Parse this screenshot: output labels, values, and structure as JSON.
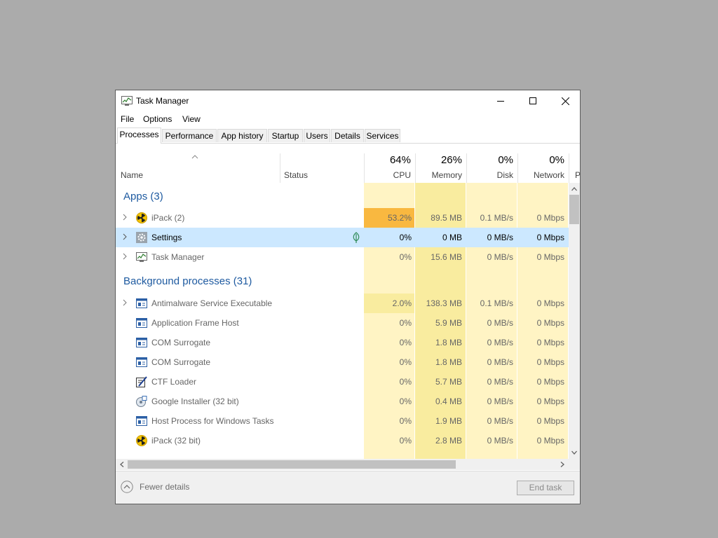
{
  "window": {
    "title": "Task Manager",
    "controls": [
      "minimize",
      "maximize",
      "close"
    ]
  },
  "menu": [
    "File",
    "Options",
    "View"
  ],
  "tabs": [
    "Processes",
    "Performance",
    "App history",
    "Startup",
    "Users",
    "Details",
    "Services"
  ],
  "active_tab": "Processes",
  "columns": {
    "name": "Name",
    "status": "Status",
    "cpu": {
      "label": "CPU",
      "total": "64%"
    },
    "memory": {
      "label": "Memory",
      "total": "26%"
    },
    "disk": {
      "label": "Disk",
      "total": "0%"
    },
    "network": {
      "label": "Network",
      "total": "0%"
    },
    "partial": "P"
  },
  "groups": {
    "apps": "Apps (3)",
    "background": "Background processes (31)"
  },
  "apps": [
    {
      "name": "iPack (2)",
      "icon": "radiation-icon",
      "expandable": true,
      "cpu": "53.2%",
      "memory": "89.5 MB",
      "disk": "0.1 MB/s",
      "network": "0 Mbps"
    },
    {
      "name": "Settings",
      "icon": "gear-icon",
      "expandable": true,
      "selected": true,
      "status_icon": "leaf-icon",
      "cpu": "0%",
      "memory": "0 MB",
      "disk": "0 MB/s",
      "network": "0 Mbps"
    },
    {
      "name": "Task Manager",
      "icon": "task-manager-icon",
      "expandable": true,
      "cpu": "0%",
      "memory": "15.6 MB",
      "disk": "0 MB/s",
      "network": "0 Mbps"
    }
  ],
  "background": [
    {
      "name": "Antimalware Service Executable",
      "icon": "window-icon",
      "expandable": true,
      "cpu": "2.0%",
      "memory": "138.3 MB",
      "disk": "0.1 MB/s",
      "network": "0 Mbps"
    },
    {
      "name": "Application Frame Host",
      "icon": "window-icon",
      "expandable": false,
      "cpu": "0%",
      "memory": "5.9 MB",
      "disk": "0 MB/s",
      "network": "0 Mbps"
    },
    {
      "name": "COM Surrogate",
      "icon": "window-icon",
      "expandable": false,
      "cpu": "0%",
      "memory": "1.8 MB",
      "disk": "0 MB/s",
      "network": "0 Mbps"
    },
    {
      "name": "COM Surrogate",
      "icon": "window-icon",
      "expandable": false,
      "cpu": "0%",
      "memory": "1.8 MB",
      "disk": "0 MB/s",
      "network": "0 Mbps"
    },
    {
      "name": "CTF Loader",
      "icon": "pen-icon",
      "expandable": false,
      "cpu": "0%",
      "memory": "5.7 MB",
      "disk": "0 MB/s",
      "network": "0 Mbps"
    },
    {
      "name": "Google Installer (32 bit)",
      "icon": "installer-icon",
      "expandable": false,
      "cpu": "0%",
      "memory": "0.4 MB",
      "disk": "0 MB/s",
      "network": "0 Mbps"
    },
    {
      "name": "Host Process for Windows Tasks",
      "icon": "window-icon",
      "expandable": false,
      "cpu": "0%",
      "memory": "1.9 MB",
      "disk": "0 MB/s",
      "network": "0 Mbps"
    },
    {
      "name": "iPack (32 bit)",
      "icon": "radiation-icon",
      "expandable": false,
      "cpu": "0%",
      "memory": "2.8 MB",
      "disk": "0 MB/s",
      "network": "0 Mbps"
    }
  ],
  "footer": {
    "fewer_details": "Fewer details",
    "end_task": "End task"
  },
  "colors": {
    "heat_light": "#fff4c4",
    "heat_mid": "#f9ec9f",
    "heat_high": "#f9b840",
    "selection": "#cce8ff",
    "group_text": "#1e5aa0"
  }
}
